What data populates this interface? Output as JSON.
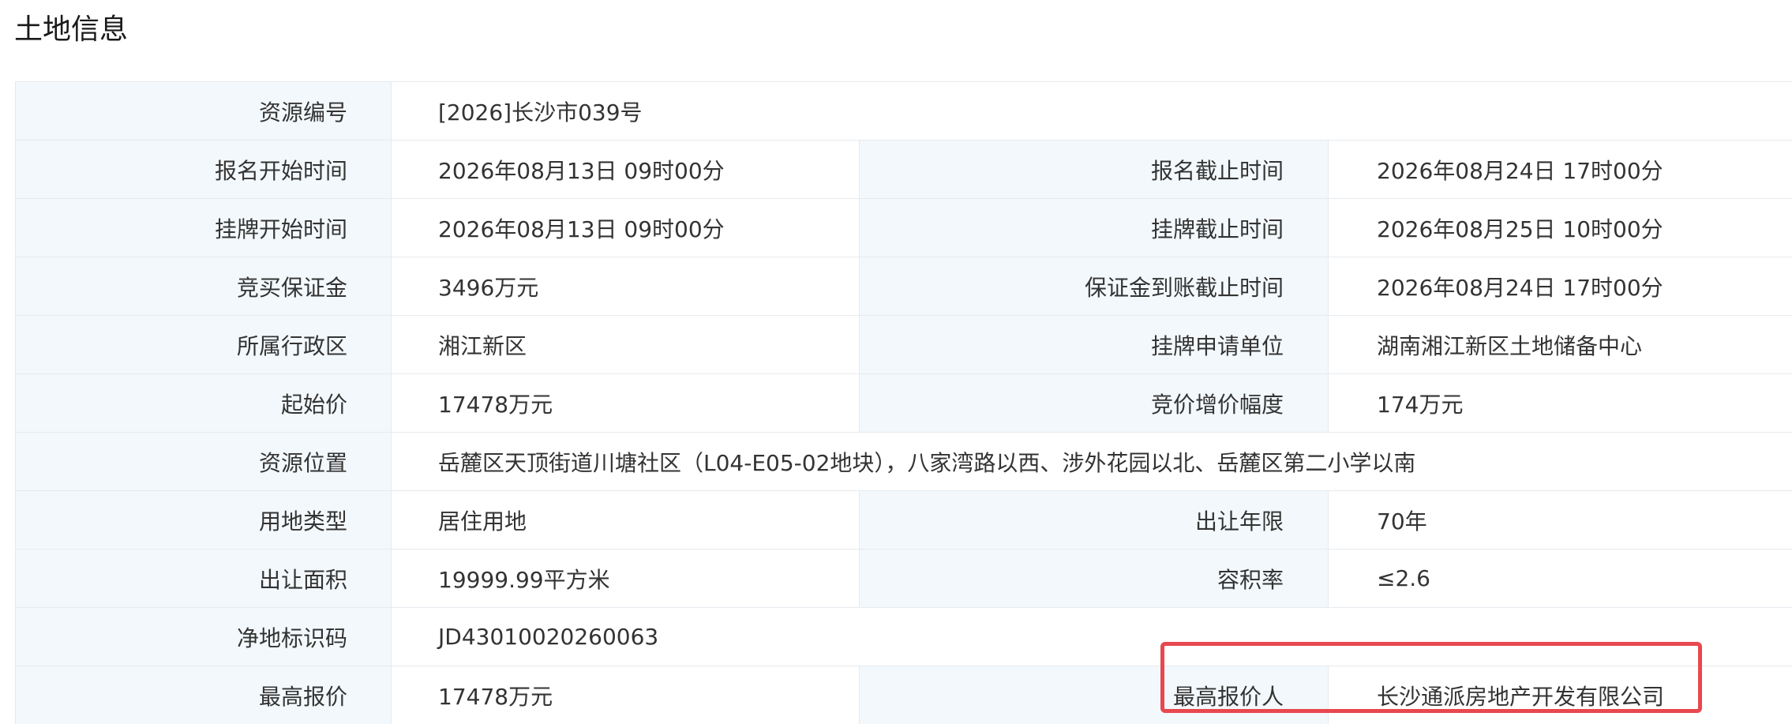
{
  "page": {
    "title": "土地信息"
  },
  "rows": {
    "r0": {
      "l1": "资源编号",
      "v1": "[2026]长沙市039号"
    },
    "r1": {
      "l1": "报名开始时间",
      "v1": "2026年08月13日 09时00分",
      "l2": "报名截止时间",
      "v2": "2026年08月24日 17时00分"
    },
    "r2": {
      "l1": "挂牌开始时间",
      "v1": "2026年08月13日 09时00分",
      "l2": "挂牌截止时间",
      "v2": "2026年08月25日 10时00分"
    },
    "r3": {
      "l1": "竞买保证金",
      "v1": "3496万元",
      "l2": "保证金到账截止时间",
      "v2": "2026年08月24日 17时00分"
    },
    "r4": {
      "l1": "所属行政区",
      "v1": "湘江新区",
      "l2": "挂牌申请单位",
      "v2": "湖南湘江新区土地储备中心"
    },
    "r5": {
      "l1": "起始价",
      "v1": "17478万元",
      "l2": "竞价增价幅度",
      "v2": "174万元"
    },
    "r6": {
      "l1": "资源位置",
      "v1": "岳麓区天顶街道川塘社区（L04-E05-02地块），八家湾路以西、涉外花园以北、岳麓区第二小学以南"
    },
    "r7": {
      "l1": "用地类型",
      "v1": "居住用地",
      "l2": "出让年限",
      "v2": "70年"
    },
    "r8": {
      "l1": "出让面积",
      "v1": "19999.99平方米",
      "l2": "容积率",
      "v2": "≤2.6"
    },
    "r9": {
      "l1": "净地标识码",
      "v1": "JD43010020260063"
    },
    "r10": {
      "l1": "最高报价",
      "v1": "17478万元",
      "l2": "最高报价人",
      "v2": "长沙通派房地产开发有限公司"
    }
  },
  "colors": {
    "label_bg": "#f3f8fc",
    "border": "#e6eaee",
    "highlight": "#e8484f"
  }
}
